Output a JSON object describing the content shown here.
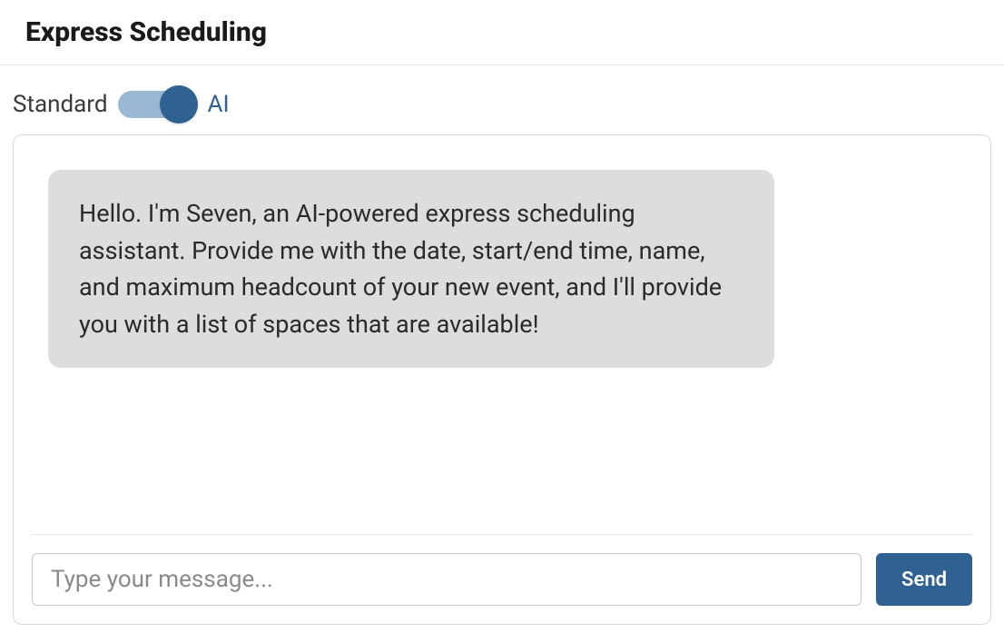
{
  "header": {
    "title": "Express Scheduling"
  },
  "toggle": {
    "left_label": "Standard",
    "right_label": "AI",
    "state": "on"
  },
  "chat": {
    "messages": [
      {
        "role": "assistant",
        "text": "Hello. I'm Seven, an AI-powered express scheduling assistant. Provide me with the date, start/end time, name, and maximum headcount of your new event, and I'll provide you with a list of spaces that are available!"
      }
    ],
    "input": {
      "value": "",
      "placeholder": "Type your message..."
    },
    "send_label": "Send"
  },
  "colors": {
    "accent": "#2f6193",
    "toggle_track": "#9bb8d3",
    "bubble_bg": "#dcdddd"
  }
}
